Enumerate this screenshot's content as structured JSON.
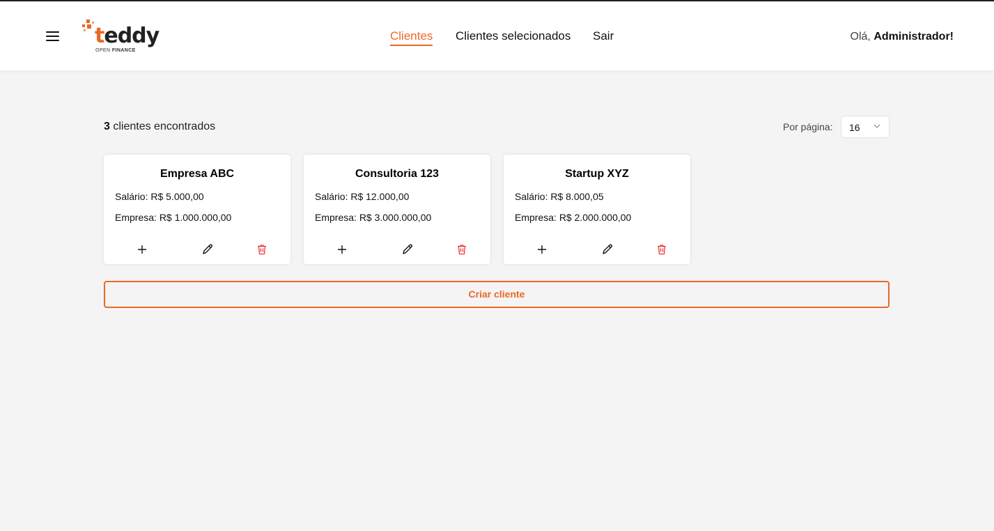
{
  "header": {
    "logo_word_t": "t",
    "logo_word_rest": "eddy",
    "logo_sub_open": "OPEN",
    "logo_sub_finance": "FINANCE",
    "nav": [
      {
        "label": "Clientes",
        "active": true
      },
      {
        "label": "Clientes selecionados",
        "active": false
      },
      {
        "label": "Sair",
        "active": false
      }
    ],
    "greeting_prefix": "Olá,",
    "greeting_name": "Administrador!"
  },
  "toolbar": {
    "count": "3",
    "count_suffix": "clientes encontrados",
    "per_page_label": "Por página:",
    "per_page_value": "16"
  },
  "clients": [
    {
      "name": "Empresa ABC",
      "salary_label": "Salário:",
      "salary": "R$ 5.000,00",
      "company_label": "Empresa:",
      "company": "R$ 1.000.000,00"
    },
    {
      "name": "Consultoria 123",
      "salary_label": "Salário:",
      "salary": "R$ 12.000,00",
      "company_label": "Empresa:",
      "company": "R$ 3.000.000,00"
    },
    {
      "name": "Startup XYZ",
      "salary_label": "Salário:",
      "salary": "R$ 8.000,05",
      "company_label": "Empresa:",
      "company": "R$ 2.000.000,00"
    }
  ],
  "create_button": "Criar cliente",
  "icons": {
    "menu": "menu-icon",
    "add": "plus-icon",
    "edit": "pencil-icon",
    "delete": "trash-icon",
    "select": "chevron-down-icon"
  },
  "colors": {
    "accent": "#ec6724",
    "danger": "#e53935",
    "background": "#f4f4f4"
  }
}
